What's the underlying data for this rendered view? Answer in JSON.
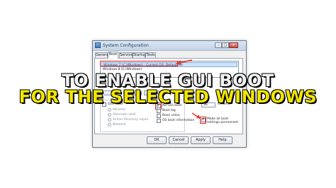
{
  "window": {
    "title": "System Configuration",
    "minimize": "–",
    "maximize": "□",
    "close": "✕"
  },
  "tabs": [
    "General",
    "Boot",
    "Services",
    "Startup",
    "Tools"
  ],
  "os_list": {
    "entries": [
      "Windows 7 (C:\\Windows) : Current OS; Default OS",
      "Windows 8 (E:\\Windows)"
    ]
  },
  "boot_options": {
    "safe_boot": "Safe boot",
    "minimal": "Minimal",
    "alternate_shell": "Alternate shell",
    "active_directory_repair": "Active Directory repair",
    "network": "Network",
    "no_gui_boot": "No GUI boot",
    "boot_log": "Boot log",
    "base_video": "Base video",
    "os_boot_information": "OS boot information",
    "timeout_value": "30",
    "timeout_unit": "seconds",
    "make_permanent": "Make all boot settings permanent"
  },
  "buttons": {
    "ok": "OK",
    "cancel": "Cancel",
    "apply": "Apply",
    "help": "Help"
  },
  "overlay": {
    "line1": "TO ENABLE GUI BOOT",
    "line2": "FOR THE SELECTED WINDOWS",
    "line1_color": "#f2f2f2",
    "line2_color": "#f2e600"
  },
  "colors": {
    "highlight_box": "#d81e1e",
    "arrow": "#e63a2a"
  }
}
